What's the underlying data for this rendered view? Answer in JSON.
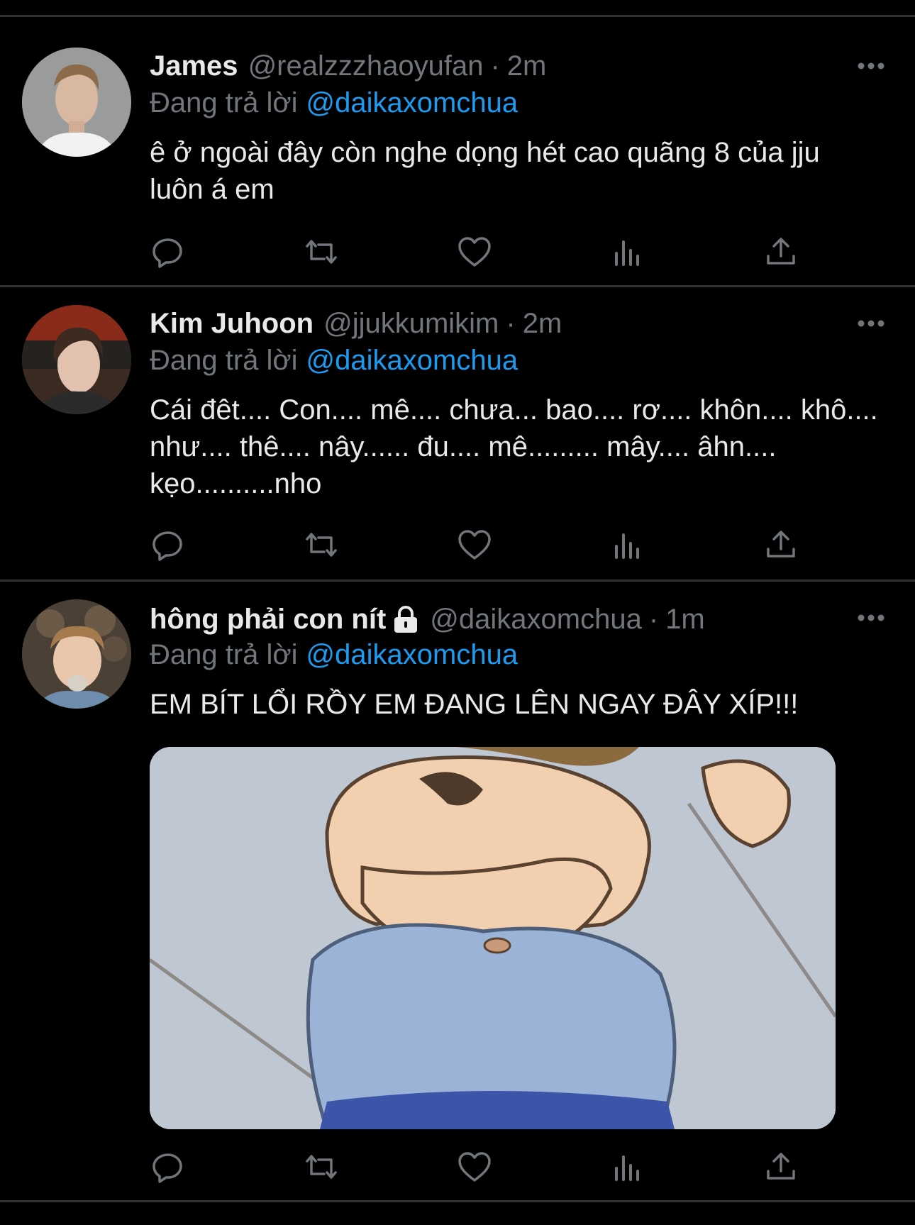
{
  "tweets": [
    {
      "name": "James",
      "handle": "@realzzzhaoyufan",
      "separator": "·",
      "time": "2m",
      "reply_prefix": "Đang trả lời",
      "reply_handle": "@daikaxomchua",
      "text": "ê ở ngoài đây còn nghe dọng hét cao quãng 8 của jju luôn á em"
    },
    {
      "name": "Kim Juhoon",
      "handle": "@jjukkumikim",
      "separator": "·",
      "time": "2m",
      "reply_prefix": "Đang trả lời",
      "reply_handle": "@daikaxomchua",
      "text": "Cái đêt.... Con.... mê.... chưa... bao.... rơ.... khôn.... khô.... như.... thê.... nây...... đu.... mê......... mây.... âhn.... kẹo..........nho"
    },
    {
      "name": "hông phải con nít",
      "handle": "@daikaxomchua",
      "separator": "·",
      "time": "1m",
      "reply_prefix": "Đang trả lời",
      "reply_handle": "@daikaxomchua",
      "text": "EM BÍT LỔI RỒY EM ĐANG LÊN NGAY ĐÂY XÍP!!!"
    }
  ],
  "colors": {
    "background": "#000000",
    "text": "#e7e9ea",
    "muted": "#71767b",
    "link": "#1d9bf0",
    "divider": "#2f3336"
  },
  "icons": [
    "reply-icon",
    "retweet-icon",
    "like-icon",
    "analytics-icon",
    "share-icon",
    "more-icon",
    "lock-icon"
  ]
}
